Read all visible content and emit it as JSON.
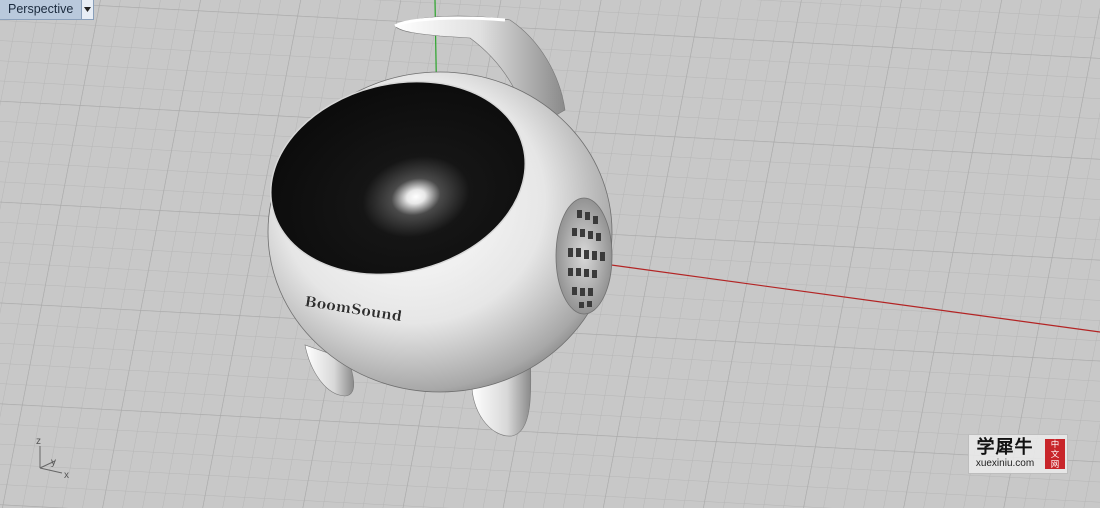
{
  "viewport": {
    "title": "Perspective",
    "dropdown_icon": "triangle-down-icon"
  },
  "model": {
    "label": "BoomSound"
  },
  "gizmo": {
    "z": "z",
    "y": "y",
    "x": "x"
  },
  "watermark": {
    "brand": "学犀牛",
    "url": "xuexiniu.com",
    "badge": [
      "中",
      "文",
      "网"
    ]
  },
  "colors": {
    "background": "#c8c8c8",
    "grid": "#b4b4b4",
    "x_axis": "#b32424",
    "y_axis": "#2aa52a",
    "tab": "#b9c9dc",
    "badge": "#c8252a"
  }
}
